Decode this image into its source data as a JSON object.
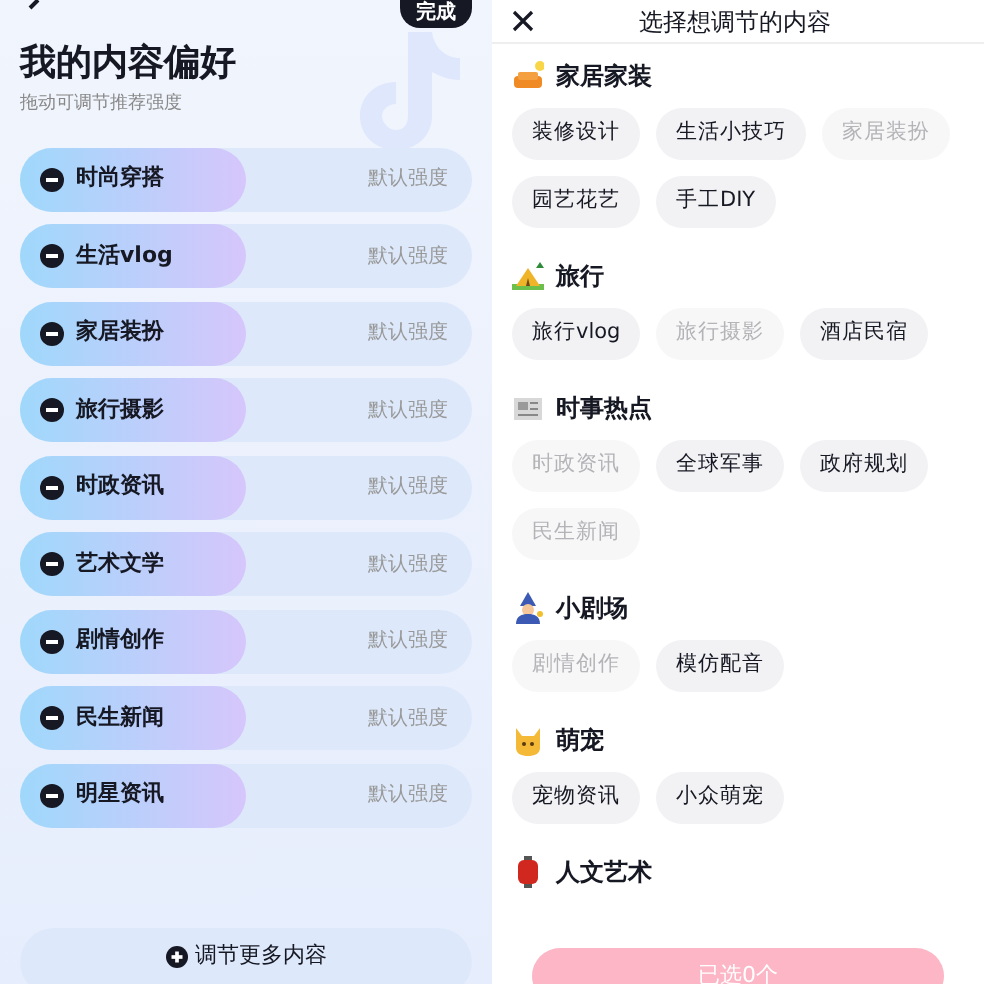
{
  "left_panel": {
    "done_button": "完成",
    "title": "我的内容偏好",
    "subtitle": "拖动可调节推荐强度",
    "preferences": [
      {
        "label": "时尚穿搭",
        "level": 0.5,
        "reading": "默认强度"
      },
      {
        "label": "生活vlog",
        "level": 0.5,
        "reading": "默认强度"
      },
      {
        "label": "家居装扮",
        "level": 0.5,
        "reading": "默认强度"
      },
      {
        "label": "旅行摄影",
        "level": 0.5,
        "reading": "默认强度"
      },
      {
        "label": "时政资讯",
        "level": 0.5,
        "reading": "默认强度"
      },
      {
        "label": "艺术文学",
        "level": 0.5,
        "reading": "默认强度"
      },
      {
        "label": "剧情创作",
        "level": 0.5,
        "reading": "默认强度"
      },
      {
        "label": "民生新闻",
        "level": 0.5,
        "reading": "默认强度"
      },
      {
        "label": "明星资讯",
        "level": 0.5,
        "reading": "默认强度"
      }
    ],
    "more_button": "调节更多内容"
  },
  "right_panel": {
    "title": "选择想调节的内容",
    "sections": [
      {
        "kind": "sofa",
        "heading": "家居家装",
        "tags": [
          {
            "label": "装修设计",
            "disabled": false
          },
          {
            "label": "生活小技巧",
            "disabled": false
          },
          {
            "label": "家居装扮",
            "disabled": true
          },
          {
            "label": "园艺花艺",
            "disabled": false
          },
          {
            "label": "手工DIY",
            "disabled": false
          }
        ]
      },
      {
        "kind": "tent",
        "heading": "旅行",
        "tags": [
          {
            "label": "旅行vlog",
            "disabled": false
          },
          {
            "label": "旅行摄影",
            "disabled": true
          },
          {
            "label": "酒店民宿",
            "disabled": false
          }
        ]
      },
      {
        "kind": "newspaper",
        "heading": "时事热点",
        "tags": [
          {
            "label": "时政资讯",
            "disabled": true
          },
          {
            "label": "全球军事",
            "disabled": false
          },
          {
            "label": "政府规划",
            "disabled": false
          },
          {
            "label": "民生新闻",
            "disabled": true
          }
        ]
      },
      {
        "kind": "wizard",
        "heading": "小剧场",
        "tags": [
          {
            "label": "剧情创作",
            "disabled": true
          },
          {
            "label": "模仿配音",
            "disabled": false
          }
        ]
      },
      {
        "kind": "cat",
        "heading": "萌宠",
        "tags": [
          {
            "label": "宠物资讯",
            "disabled": false
          },
          {
            "label": "小众萌宠",
            "disabled": false
          }
        ]
      },
      {
        "kind": "lantern",
        "heading": "人文艺术"
      }
    ],
    "confirm_button": {
      "label": "已选0个",
      "disabled": true
    }
  }
}
